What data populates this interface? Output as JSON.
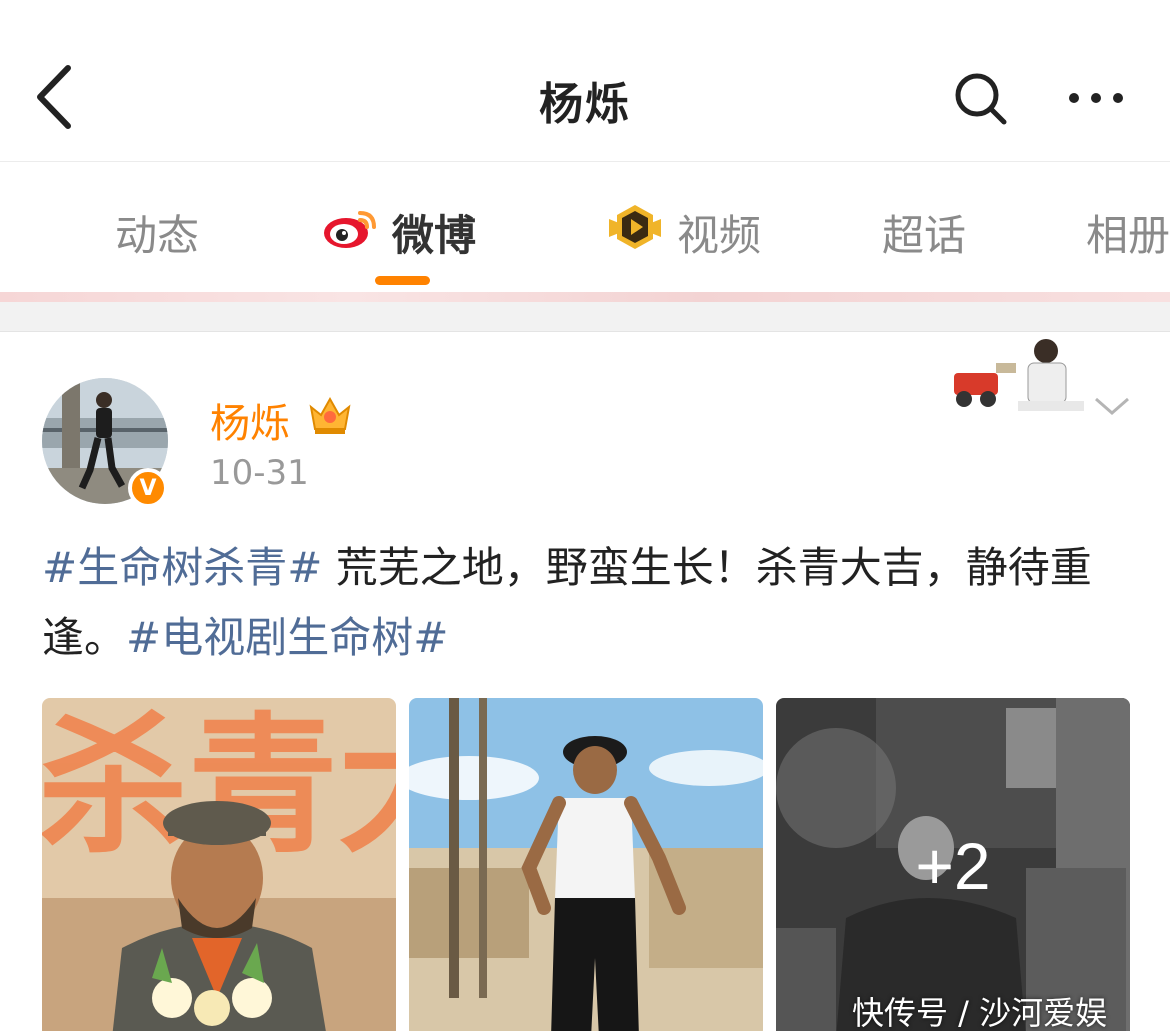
{
  "header": {
    "title": "杨烁",
    "back_icon": "chevron-left-icon",
    "search_icon": "search-icon",
    "more_icon": "more-dots-icon"
  },
  "tabs": [
    {
      "label": "动态",
      "active": false
    },
    {
      "label": "微博",
      "active": true,
      "icon": "weibo-logo-icon"
    },
    {
      "label": "视频",
      "active": false,
      "icon": "video-play-badge-icon"
    },
    {
      "label": "超话",
      "active": false
    },
    {
      "label": "相册",
      "active": false
    }
  ],
  "accent_color": "#ff8200",
  "topic_color": "#506c96",
  "post": {
    "author": "杨烁",
    "date": "10-31",
    "verified_badge": "V",
    "text_parts": [
      {
        "text": "#生命树杀青#",
        "type": "topic"
      },
      {
        "text": " 荒芜之地，野蛮生长！杀青大吉，静待重逢。",
        "type": "plain"
      },
      {
        "text": "#电视剧生命树#",
        "type": "topic"
      }
    ],
    "images": [
      {
        "description_icon": "photo-poster",
        "overlay_text": "杀青大吉"
      },
      {
        "description_icon": "photo-man-walking"
      },
      {
        "description_icon": "photo-bw-portrait",
        "more_count": "+2"
      }
    ]
  },
  "watermark": "快传号 / 沙河爱娱"
}
